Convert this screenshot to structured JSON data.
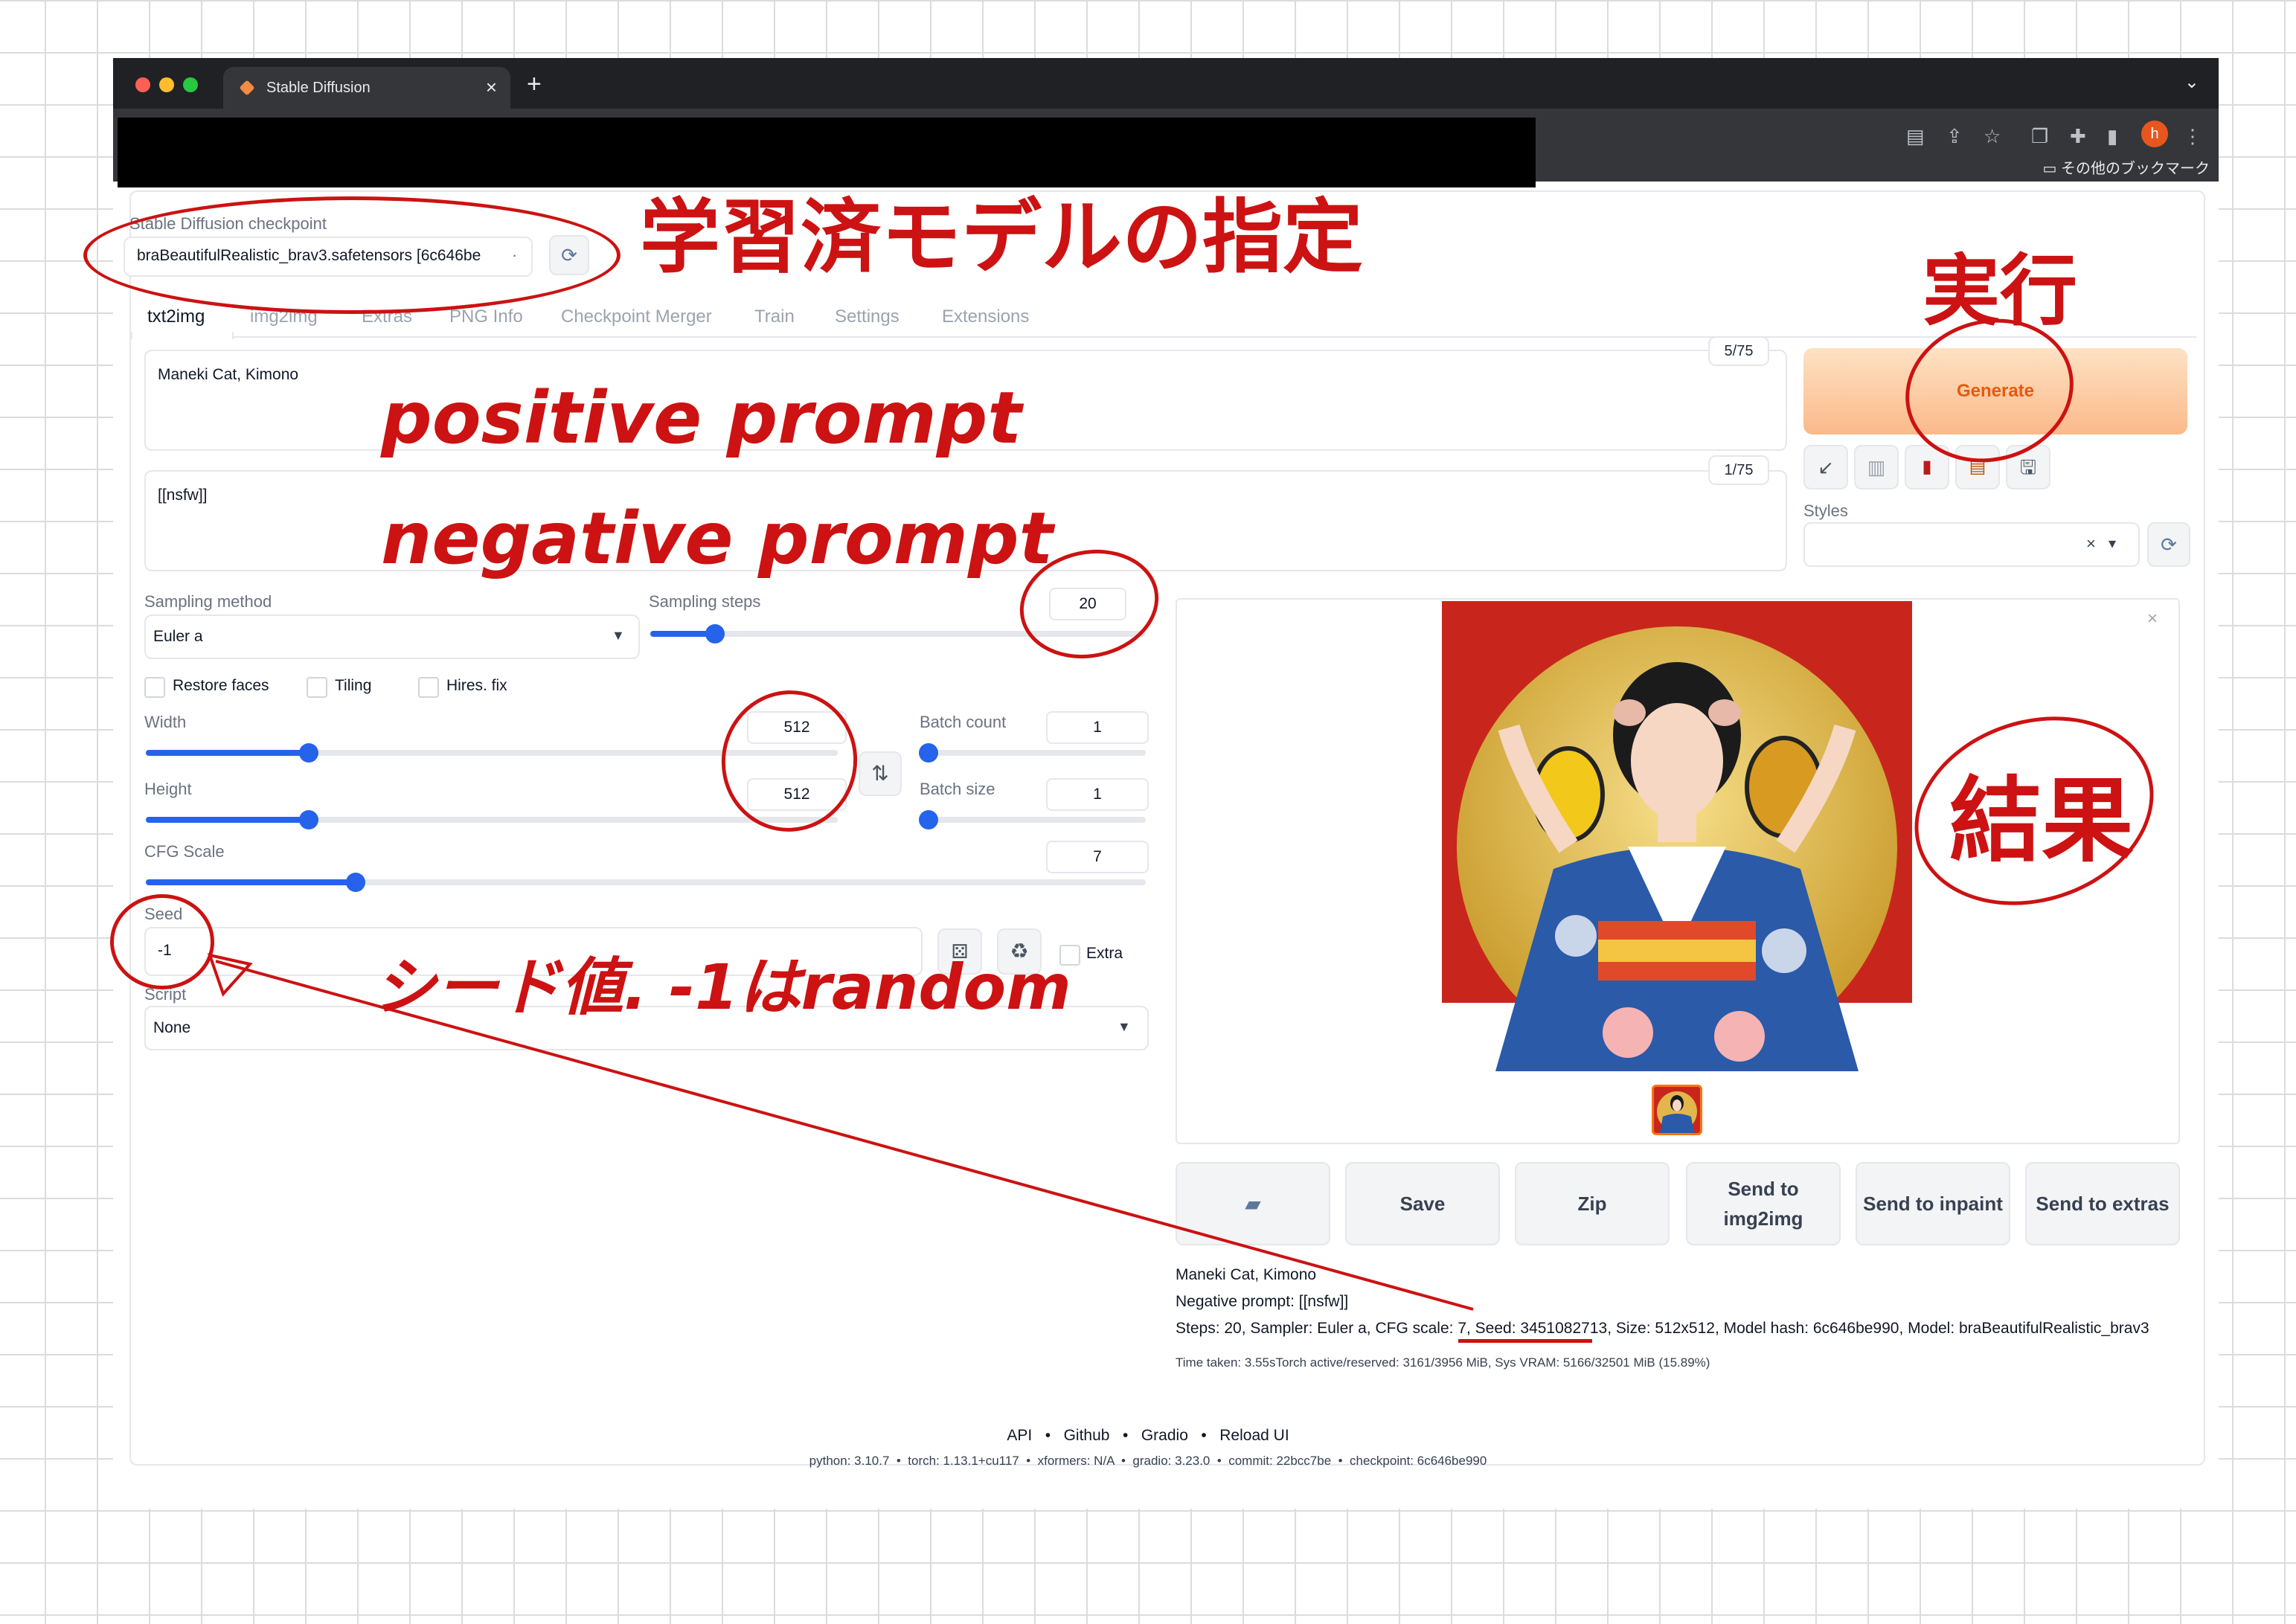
{
  "browser": {
    "tab_title": "Stable Diffusion",
    "new_tab": "+",
    "tab_close": "×",
    "profile_initial": "h",
    "bookmarks_label": "その他のブックマーク",
    "tab_menu": "⌄"
  },
  "checkpoint": {
    "label": "Stable Diffusion checkpoint",
    "value": "braBeautifulRealistic_brav3.safetensors [6c646be",
    "dropdown_arrow": "·"
  },
  "tabs": [
    "txt2img",
    "img2img",
    "Extras",
    "PNG Info",
    "Checkpoint Merger",
    "Train",
    "Settings",
    "Extensions"
  ],
  "prompt": {
    "text": "Maneki Cat, Kimono",
    "counter": "5/75"
  },
  "negative_prompt": {
    "text": "[[nsfw]]",
    "counter": "1/75"
  },
  "generate": {
    "label": "Generate"
  },
  "styles": {
    "label": "Styles",
    "clear": "×",
    "arrow": "▾"
  },
  "sampling_method": {
    "label": "Sampling method",
    "value": "Euler a"
  },
  "sampling_steps": {
    "label": "Sampling steps",
    "value": "20",
    "fraction": 0.13
  },
  "checkboxes": [
    "Restore faces",
    "Tiling",
    "Hires. fix"
  ],
  "width": {
    "label": "Width",
    "value": "512",
    "fraction": 0.235
  },
  "height": {
    "label": "Height",
    "value": "512",
    "fraction": 0.235
  },
  "batch_count": {
    "label": "Batch count",
    "value": "1",
    "fraction": 0.0
  },
  "batch_size": {
    "label": "Batch size",
    "value": "1",
    "fraction": 0.0
  },
  "swap_icon": "⇅",
  "cfg_scale": {
    "label": "CFG Scale",
    "value": "7",
    "fraction": 0.21
  },
  "seed": {
    "label": "Seed",
    "value": "-1",
    "extra_label": "Extra",
    "recycle_icon": "♻"
  },
  "script": {
    "label": "Script",
    "value": "None"
  },
  "output_buttons": [
    {
      "name": "folder",
      "label": ""
    },
    {
      "name": "save",
      "label": "Save"
    },
    {
      "name": "zip",
      "label": "Zip"
    },
    {
      "name": "send-img2img",
      "label": "Send to img2img"
    },
    {
      "name": "send-inpaint",
      "label": "Send to inpaint"
    },
    {
      "name": "send-extras",
      "label": "Send to extras"
    }
  ],
  "gallery_close": "×",
  "info": {
    "prompt": "Maneki Cat, Kimono",
    "negative": "Negative prompt: [[nsfw]]",
    "params_prefix": "Steps: 20, Sampler: Euler a, CFG scale: 7, ",
    "params_seed": "Seed: 3451082713",
    "params_suffix": ", Size: 512x512, Model hash: 6c646be990, Model: braBeautifulRealistic_brav3",
    "time": "Time taken: 3.55sTorch active/reserved: 3161/3956 MiB, Sys VRAM: 5166/32501 MiB (15.89%)"
  },
  "footer": {
    "links": [
      "API",
      "Github",
      "Gradio",
      "Reload UI"
    ],
    "separator": "•",
    "versions": "python: 3.10.7  •  torch: 1.13.1+cu117  •  xformers: N/A  •  gradio: 3.23.0  •  commit: 22bcc7be  •  checkpoint: 6c646be990"
  },
  "annotations": {
    "model": "学習済モデルの指定",
    "execute": "実行",
    "positive": "positive prompt",
    "negative": "negative prompt",
    "result": "結果",
    "seed": "シード値. -1はrandom"
  },
  "colors": {
    "annotation_red": "#cc1212",
    "generate_orange": "#ea580c",
    "slider_blue": "#2563eb",
    "chrome_dark": "#202124"
  }
}
